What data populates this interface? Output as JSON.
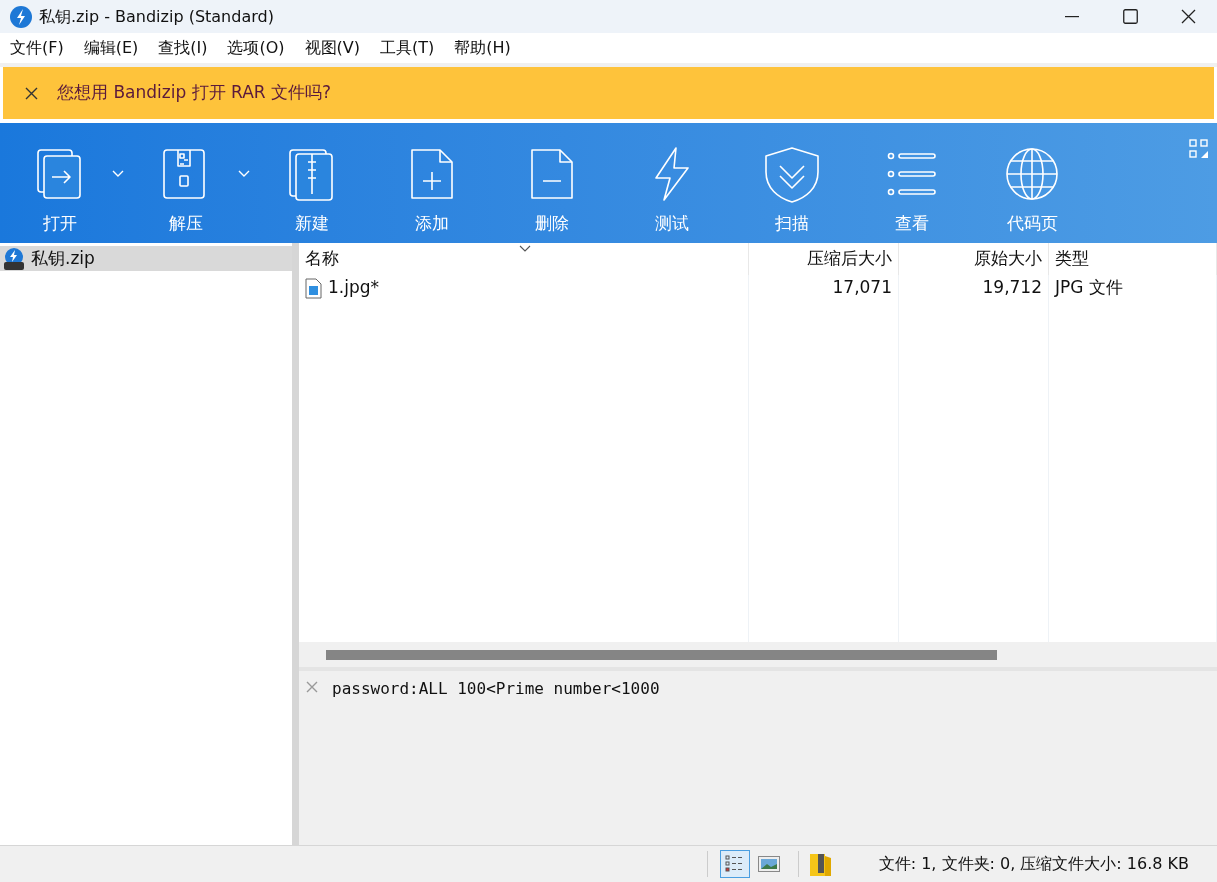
{
  "window": {
    "title": "私钥.zip - Bandizip (Standard)"
  },
  "menu": [
    "文件(F)",
    "编辑(E)",
    "查找(I)",
    "选项(O)",
    "视图(V)",
    "工具(T)",
    "帮助(H)"
  ],
  "banner": {
    "text": "您想用 Bandizip 打开 RAR 文件吗?"
  },
  "toolbar": [
    {
      "kind": "open",
      "label": "打开",
      "dropdown": true
    },
    {
      "kind": "extract",
      "label": "解压",
      "dropdown": true
    },
    {
      "kind": "new",
      "label": "新建",
      "dropdown": false
    },
    {
      "kind": "add",
      "label": "添加",
      "dropdown": false
    },
    {
      "kind": "delete",
      "label": "删除",
      "dropdown": false
    },
    {
      "kind": "test",
      "label": "测试",
      "dropdown": false
    },
    {
      "kind": "scan",
      "label": "扫描",
      "dropdown": false
    },
    {
      "kind": "view",
      "label": "查看",
      "dropdown": false
    },
    {
      "kind": "codepage",
      "label": "代码页",
      "dropdown": false
    }
  ],
  "tree": [
    {
      "label": "私钥.zip",
      "selected": true
    }
  ],
  "table": {
    "columns": [
      {
        "label": "名称"
      },
      {
        "label": "压缩后大小"
      },
      {
        "label": "原始大小"
      },
      {
        "label": "类型"
      }
    ],
    "rows": [
      [
        "1.jpg*",
        "17,071",
        "19,712",
        "JPG 文件"
      ]
    ]
  },
  "comment": "password:ALL 100<Prime number<1000",
  "status_bar": {
    "views": [
      {
        "kind": "details",
        "selected": true
      },
      {
        "kind": "thumbnails",
        "selected": false
      }
    ],
    "text": "文件: 1, 文件夹: 0, 压缩文件大小: 16.8 KB"
  }
}
